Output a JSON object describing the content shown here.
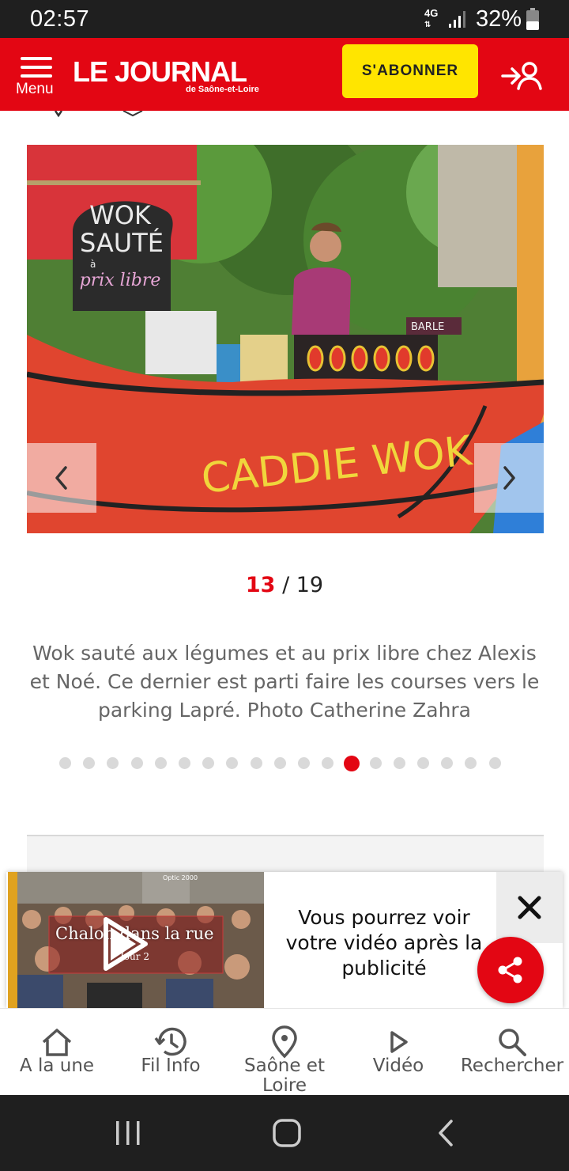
{
  "status_bar": {
    "time": "02:57",
    "network": "4G",
    "battery": "32%"
  },
  "header": {
    "menu_label": "Menu",
    "logo_main": "LE JOURNAL",
    "logo_sub": "de Saône-et-Loire",
    "subscribe_label": "S'ABONNER",
    "brand_color": "#e30613",
    "subscribe_color": "#ffe500"
  },
  "gallery": {
    "current": "13",
    "total": "/ 19",
    "caption": "Wok sauté aux légumes et au prix libre chez Alexis et Noé. Ce dernier est parti faire les courses vers le parking Lapré. Photo Catherine Zahra",
    "dot_count": 19,
    "active_dot": 13,
    "photo_sign_line1": "WOK",
    "photo_sign_line2": "SAUTÉ",
    "photo_sign_line3": "à",
    "photo_sign_line4": "prix libre",
    "photo_boat_text": "CADDIE WOK",
    "photo_awning_text": "BARLE"
  },
  "video_ad": {
    "thumb_title": "Chalon dans la rue",
    "thumb_subtitle": "Jour 2",
    "thumb_logo": "Optic 2000",
    "message": "Vous pourrez voir votre vidéo après la publicité"
  },
  "bottom_nav": {
    "items": [
      {
        "label": "A la une",
        "icon": "home-icon"
      },
      {
        "label": "Fil Info",
        "icon": "history-icon"
      },
      {
        "label": "Saône et Loire",
        "icon": "location-pin-icon"
      },
      {
        "label": "Vidéo",
        "icon": "play-icon"
      },
      {
        "label": "Rechercher",
        "icon": "search-icon"
      }
    ]
  }
}
